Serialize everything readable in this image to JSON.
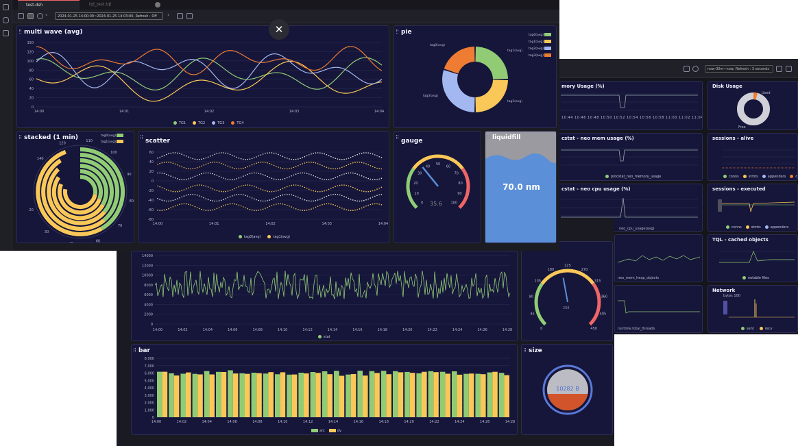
{
  "window_back": {
    "toolbar": {
      "time_range": "now-30m~now, Refresh : 3 seconds"
    },
    "panels": {
      "memory": {
        "title": "mory Usage (%)",
        "xticks": [
          "10:44",
          "10:46",
          "10:48",
          "10:50",
          "10:52",
          "10:54",
          "10:56",
          "10:58",
          "11:00",
          "11:02",
          "11:04",
          "11:06",
          "11:08",
          "11:10",
          "11:12"
        ]
      },
      "disk": {
        "title": "Disk Usage",
        "used_label": "Used",
        "free_label": "Free",
        "used_fraction": 0.04
      },
      "neo_mem": {
        "title": "cstat - neo mem usage (%)",
        "legend": [
          "procstat_neo_memory_usage"
        ]
      },
      "sessions_alive": {
        "title": "sessions - alive",
        "legend": [
          "conns",
          "stmts",
          "appenders",
          "conns-raw"
        ]
      },
      "neo_cpu": {
        "title": "cstat - neo cpu usage (%)",
        "legend_partial": "neo_cpu_usage(avg)"
      },
      "sessions_exec": {
        "title": "sessions - executed",
        "legend": [
          "conns",
          "stmts",
          "appenders"
        ]
      },
      "heap": {
        "legend_partial": "neo_mem_heap_objects"
      },
      "tql": {
        "title": "TQL - cached objects",
        "legend": [
          "notable files"
        ]
      },
      "threads": {
        "legend_partial": "runtime.total_threads"
      },
      "network": {
        "title": "Network",
        "subtitle": "bytes 100",
        "legend": [
          "sent",
          "recv"
        ]
      }
    }
  },
  "window_mid": {
    "line": {
      "yticks": [
        "14000",
        "12000",
        "10000",
        "8000",
        "6000",
        "4000",
        "2000",
        "0"
      ],
      "xticks": [
        "14:00",
        "14:02",
        "14:04",
        "14:06",
        "14:08",
        "14:10",
        "14:12",
        "14:14",
        "14:16",
        "14:18",
        "14:20",
        "14:22",
        "14:24",
        "14:26",
        "14:28"
      ],
      "legend": [
        "stat"
      ]
    },
    "gauge": {
      "ticks": [
        "0",
        "45",
        "90",
        "135",
        "180",
        "225",
        "270",
        "315",
        "360",
        "405",
        "450"
      ],
      "value_label": "208"
    },
    "bar": {
      "title": "bar",
      "yticks": [
        "8,000",
        "7,000",
        "6,000",
        "5,000",
        "4,000",
        "3,000",
        "2,000",
        "1,000",
        "0"
      ],
      "xticks": [
        "14:00",
        "14:02",
        "14:04",
        "14:06",
        "14:08",
        "14:10",
        "14:12",
        "14:14",
        "14:16",
        "14:18",
        "14:20",
        "14:22",
        "14:24",
        "14:26",
        "14:28"
      ],
      "legend": [
        "arc",
        "dv"
      ]
    },
    "size": {
      "title": "size",
      "value": "10282 B",
      "fill_fraction": 0.38
    }
  },
  "window_front": {
    "tabs": [
      {
        "label": "test.dsh"
      },
      {
        "label": "tql_test.tql"
      }
    ],
    "toolbar": {
      "time_range": "2024-01-25 14:00:00~2024-01-25 14:03:00, Refresh : Off"
    },
    "close_label": "✕",
    "multi_wave": {
      "title": "multi wave (avg)",
      "yticks": [
        "150",
        "120",
        "100",
        "80",
        "60",
        "40",
        "20",
        "0"
      ],
      "xticks": [
        "14:00",
        "14:01",
        "14:02",
        "14:03",
        "14:04"
      ],
      "legend": [
        "TG1",
        "TG2",
        "TG3",
        "TG4"
      ]
    },
    "pie": {
      "title": "pie",
      "legend": [
        "tag0(avg)",
        "tag1(avg)",
        "tag2(avg)",
        "tag3(avg)"
      ],
      "labels": [
        "tag0(avg)",
        "tag1(avg)",
        "tag2(avg)",
        "tag3(avg)"
      ]
    },
    "stacked": {
      "title": "stacked (1 min)",
      "legend": [
        "tag0(avg)",
        "tag1(avg)"
      ],
      "ticks": [
        "140",
        "120",
        "110",
        "100",
        "90",
        "80",
        "70",
        "60",
        "40",
        "30",
        "20"
      ]
    },
    "scatter": {
      "title": "scatter",
      "yticks": [
        "60",
        "40",
        "20",
        "0",
        "-20",
        "-40",
        "-60",
        "-80"
      ],
      "xticks": [
        "14:00",
        "14:01",
        "14:02",
        "14:03",
        "14:04"
      ],
      "legend": [
        "tag0(avg)",
        "tag1(avg)"
      ]
    },
    "gauge": {
      "title": "gauge",
      "ticks": [
        "0",
        "10",
        "20",
        "30",
        "40",
        "50",
        "60",
        "70",
        "80",
        "90",
        "100"
      ],
      "value": "35.6",
      "value_fraction": 0.356
    },
    "liquid": {
      "title": "liquidfill",
      "value": "70.0 nm",
      "fill_fraction": 0.7
    }
  },
  "colors": {
    "bg": "#16163a",
    "green": "#91cc75",
    "yellow": "#fac858",
    "blue": "#a3b8f0",
    "orange": "#ee7c33",
    "red": "#ee6666"
  },
  "chart_data": [
    {
      "type": "line",
      "title": "multi wave (avg)",
      "ylim": [
        0,
        150
      ],
      "series": [
        {
          "name": "TG1"
        },
        {
          "name": "TG2"
        },
        {
          "name": "TG3"
        },
        {
          "name": "TG4"
        }
      ]
    },
    {
      "type": "pie",
      "title": "pie",
      "categories": [
        "tag0(avg)",
        "tag1(avg)",
        "tag2(avg)",
        "tag3(avg)"
      ],
      "values": [
        25,
        25,
        30,
        20
      ]
    },
    {
      "type": "bar",
      "title": "bar",
      "ylim": [
        0,
        8000
      ],
      "series": [
        {
          "name": "arc"
        },
        {
          "name": "dv"
        }
      ]
    }
  ]
}
